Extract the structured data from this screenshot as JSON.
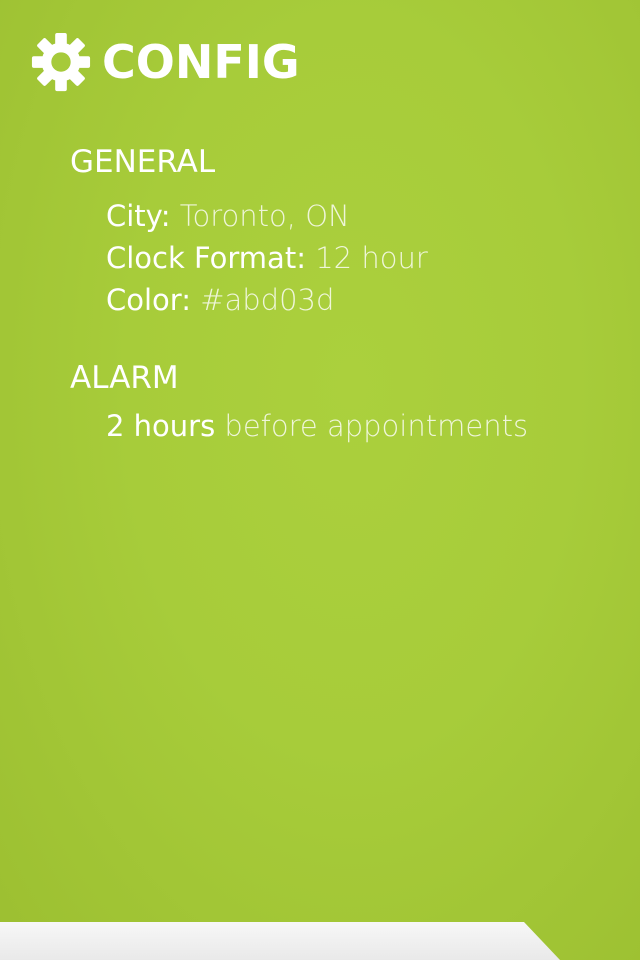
{
  "header": {
    "title": "CONFIG",
    "icon": "gear-icon"
  },
  "general": {
    "heading": "GENERAL",
    "city_label": "City:",
    "city_value": "Toronto, ON",
    "clock_label": "Clock Format:",
    "clock_value": "12 hour",
    "color_label": "Color:",
    "color_value": "#abd03d"
  },
  "alarm": {
    "heading": "ALARM",
    "amount": "2 hours",
    "suffix": "before appointments"
  },
  "colors": {
    "background": "#abd03d",
    "text": "#ffffff",
    "bottom_bar": "#f2f2f2"
  }
}
